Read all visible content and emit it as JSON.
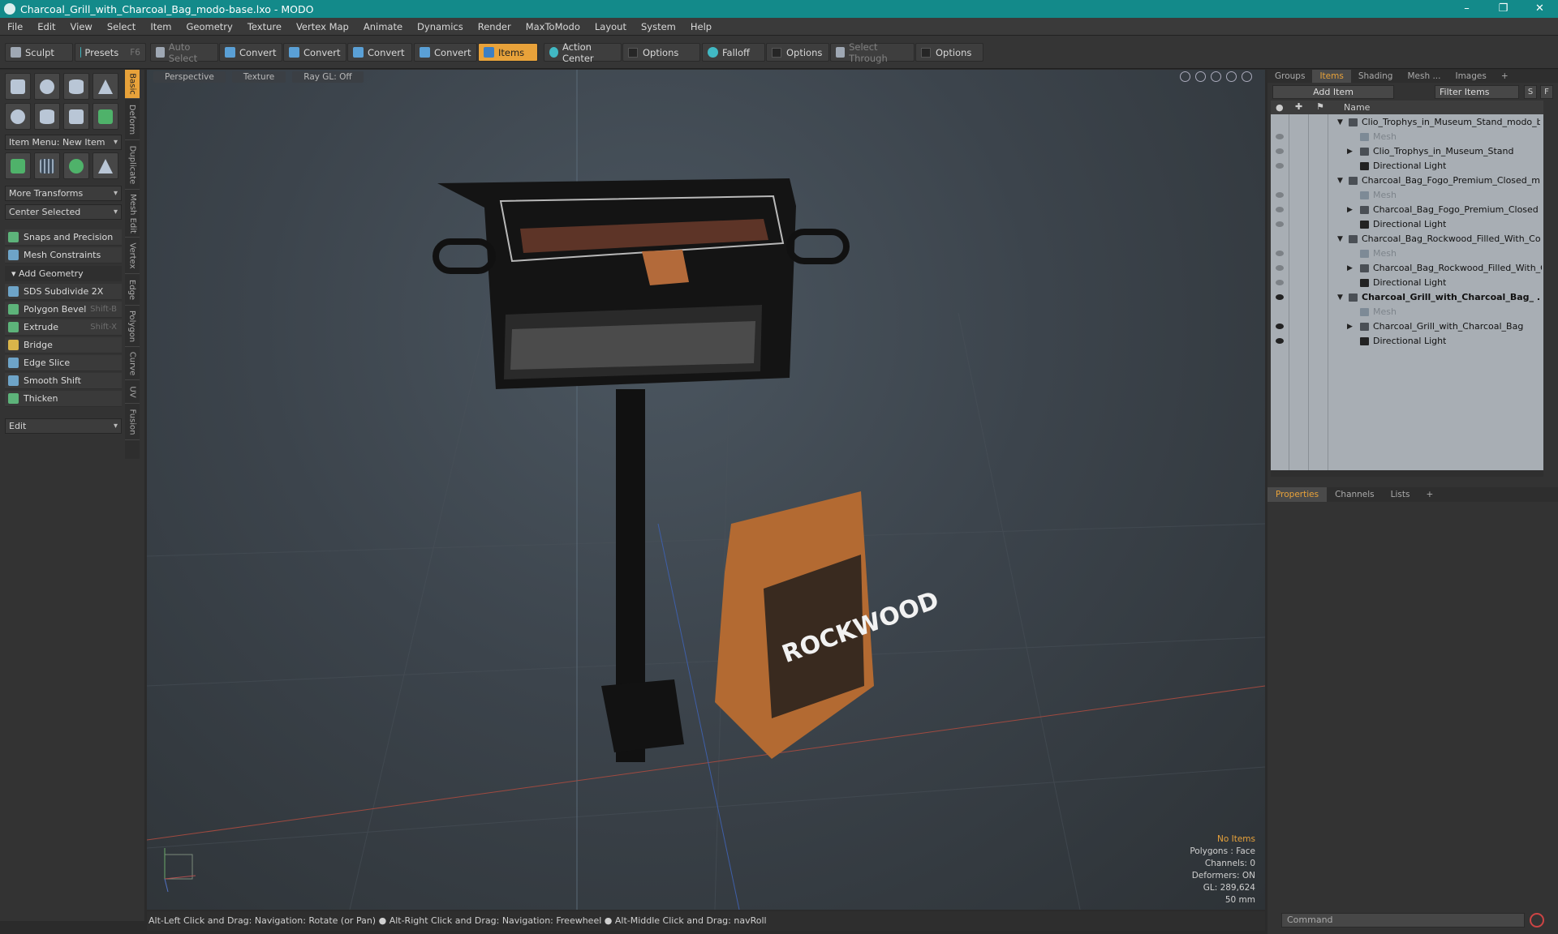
{
  "window": {
    "title": "Charcoal_Grill_with_Charcoal_Bag_modo-base.lxo - MODO",
    "minimize": "–",
    "maximize": "❐",
    "close": "✕"
  },
  "menu": [
    "File",
    "Edit",
    "View",
    "Select",
    "Item",
    "Geometry",
    "Texture",
    "Vertex Map",
    "Animate",
    "Dynamics",
    "Render",
    "MaxToModo",
    "Layout",
    "System",
    "Help"
  ],
  "toolbar": {
    "sculpt": "Sculpt",
    "presets": "Presets",
    "presets_key": "F6",
    "auto_select": "Auto Select",
    "convert": "Convert",
    "items": "Items",
    "action_center": "Action Center",
    "options": "Options",
    "falloff": "Falloff",
    "select_through": "Select Through"
  },
  "left": {
    "item_menu": "Item Menu: New Item",
    "more_transforms": "More Transforms",
    "center_selected": "Center Selected",
    "snaps": "Snaps and Precision",
    "mesh_constraints": "Mesh Constraints",
    "add_geometry": "Add Geometry",
    "tools": [
      {
        "label": "SDS Subdivide 2X",
        "key": ""
      },
      {
        "label": "Polygon Bevel",
        "key": "Shift-B"
      },
      {
        "label": "Extrude",
        "key": "Shift-X"
      },
      {
        "label": "Bridge",
        "key": ""
      },
      {
        "label": "Edge Slice",
        "key": ""
      },
      {
        "label": "Smooth Shift",
        "key": ""
      },
      {
        "label": "Thicken",
        "key": ""
      }
    ],
    "edit": "Edit",
    "vtabs": [
      "Basic",
      "Deform",
      "Duplicate",
      "Mesh Edit",
      "Vertex",
      "Edge",
      "Polygon",
      "Curve",
      "UV",
      "Fusion"
    ]
  },
  "viewport": {
    "tabs": [
      "Perspective",
      "Texture",
      "Ray GL: Off"
    ],
    "bag_text": "ROCKWOOD",
    "stats": {
      "selection": "No Items",
      "polygons": "Polygons : Face",
      "channels": "Channels: 0",
      "deformers": "Deformers: ON",
      "gl": "GL: 289,624",
      "focal": "50 mm"
    }
  },
  "status": "Alt-Left Click and Drag: Navigation: Rotate (or Pan) ● Alt-Right Click and Drag: Navigation: Freewheel ● Alt-Middle Click and Drag: navRoll",
  "right": {
    "tabs": [
      "Groups",
      "Items",
      "Shading",
      "Mesh ...",
      "Images",
      "+"
    ],
    "add_item": "Add Item",
    "filter": "Filter Items",
    "s": "S",
    "f": "F",
    "col_name": "Name",
    "rows": [
      {
        "label": "Clio_Trophys_in_Museum_Stand_modo_ba ...",
        "level": 0,
        "type": "scene"
      },
      {
        "label": "Mesh",
        "level": 1,
        "type": "mesh"
      },
      {
        "label": "Clio_Trophys_in_Museum_Stand",
        "level": 1,
        "type": "group"
      },
      {
        "label": "Directional Light",
        "level": 1,
        "type": "light"
      },
      {
        "label": "Charcoal_Bag_Fogo_Premium_Closed_mod...",
        "level": 0,
        "type": "scene"
      },
      {
        "label": "Mesh",
        "level": 1,
        "type": "mesh"
      },
      {
        "label": "Charcoal_Bag_Fogo_Premium_Closed",
        "level": 1,
        "type": "group"
      },
      {
        "label": "Directional Light",
        "level": 1,
        "type": "light"
      },
      {
        "label": "Charcoal_Bag_Rockwood_Filled_With_Coal...",
        "level": 0,
        "type": "scene"
      },
      {
        "label": "Mesh",
        "level": 1,
        "type": "mesh"
      },
      {
        "label": "Charcoal_Bag_Rockwood_Filled_With_Coal",
        "level": 1,
        "type": "group"
      },
      {
        "label": "Directional Light",
        "level": 1,
        "type": "light"
      },
      {
        "label": "Charcoal_Grill_with_Charcoal_Bag_ ...",
        "level": 0,
        "type": "scene",
        "bold": true
      },
      {
        "label": "Mesh",
        "level": 1,
        "type": "mesh"
      },
      {
        "label": "Charcoal_Grill_with_Charcoal_Bag",
        "level": 1,
        "type": "group"
      },
      {
        "label": "Directional Light",
        "level": 1,
        "type": "light"
      }
    ],
    "prop_tabs": [
      "Properties",
      "Channels",
      "Lists",
      "+"
    ],
    "command": "Command"
  }
}
